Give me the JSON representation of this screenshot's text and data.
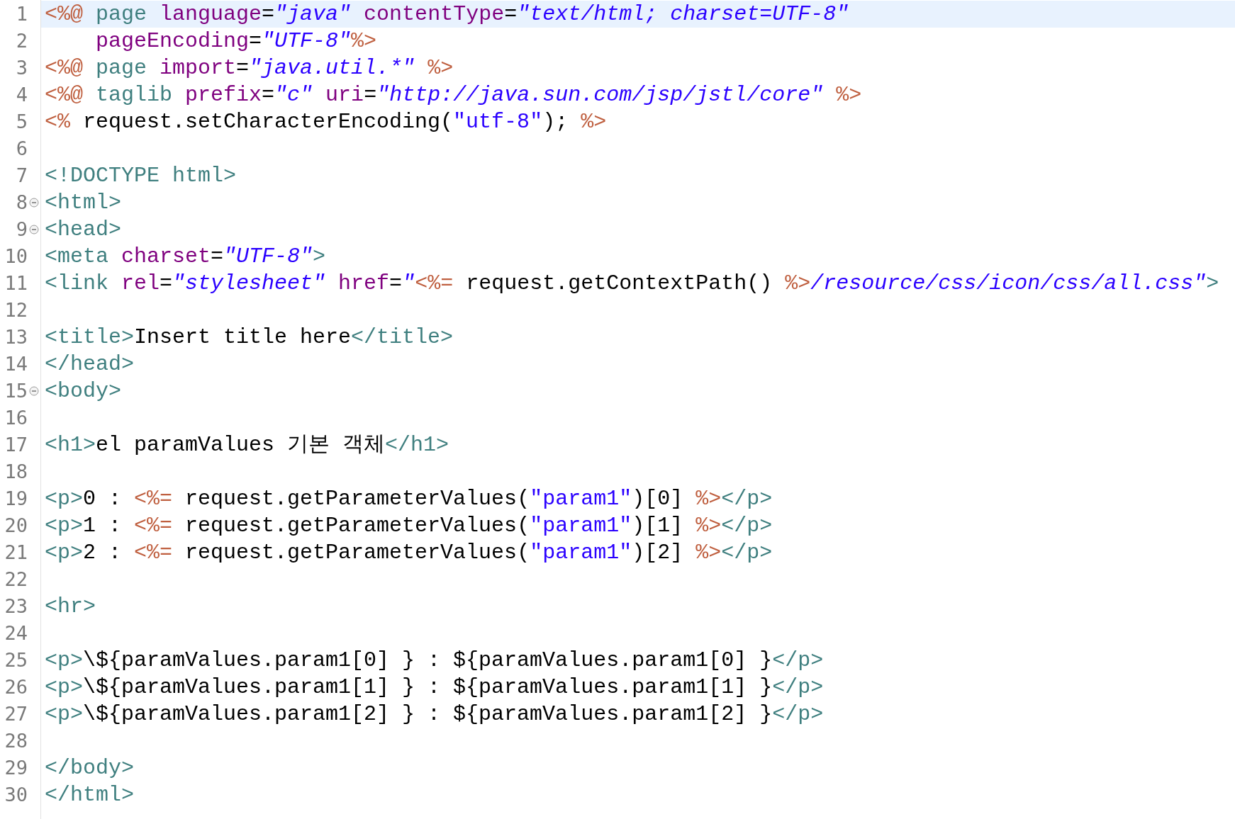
{
  "editor": {
    "lines": [
      {
        "number": "1",
        "current": true,
        "tokens": [
          {
            "kind": "jsp",
            "text": "<%@"
          },
          {
            "kind": "tag",
            "text": " page"
          },
          {
            "kind": "attr",
            "text": " language"
          },
          {
            "kind": "text",
            "text": "="
          },
          {
            "kind": "str",
            "text": "\"java\""
          },
          {
            "kind": "attr",
            "text": " contentType"
          },
          {
            "kind": "text",
            "text": "="
          },
          {
            "kind": "str",
            "text": "\"text/html; charset=UTF-8\""
          }
        ]
      },
      {
        "number": "2",
        "current": false,
        "tokens": [
          {
            "kind": "attr",
            "text": "    pageEncoding"
          },
          {
            "kind": "text",
            "text": "="
          },
          {
            "kind": "str",
            "text": "\"UTF-8\""
          },
          {
            "kind": "jsp",
            "text": "%>"
          }
        ]
      },
      {
        "number": "3",
        "current": false,
        "tokens": [
          {
            "kind": "jsp",
            "text": "<%@"
          },
          {
            "kind": "tag",
            "text": " page"
          },
          {
            "kind": "attr",
            "text": " import"
          },
          {
            "kind": "text",
            "text": "="
          },
          {
            "kind": "str",
            "text": "\"java.util.*\""
          },
          {
            "kind": "jsp",
            "text": " %>"
          }
        ]
      },
      {
        "number": "4",
        "current": false,
        "tokens": [
          {
            "kind": "jsp",
            "text": "<%@"
          },
          {
            "kind": "tag",
            "text": " taglib"
          },
          {
            "kind": "attr",
            "text": " prefix"
          },
          {
            "kind": "text",
            "text": "="
          },
          {
            "kind": "str",
            "text": "\"c\""
          },
          {
            "kind": "attr",
            "text": " uri"
          },
          {
            "kind": "text",
            "text": "="
          },
          {
            "kind": "str",
            "text": "\"http://java.sun.com/jsp/jstl/core\""
          },
          {
            "kind": "jsp",
            "text": " %>"
          }
        ]
      },
      {
        "number": "5",
        "current": false,
        "tokens": [
          {
            "kind": "jsp",
            "text": "<%"
          },
          {
            "kind": "text",
            "text": " request.setCharacterEncoding("
          },
          {
            "kind": "jstr",
            "text": "\"utf-8\""
          },
          {
            "kind": "text",
            "text": ");"
          },
          {
            "kind": "jsp",
            "text": " %>"
          }
        ]
      },
      {
        "number": "6",
        "current": false
      },
      {
        "number": "7",
        "current": false,
        "tokens": [
          {
            "kind": "tag",
            "text": "<!DOCTYPE html>"
          }
        ]
      },
      {
        "number": "8",
        "current": false,
        "foldable": true,
        "tokens": [
          {
            "kind": "tag",
            "text": "<html>"
          }
        ]
      },
      {
        "number": "9",
        "current": false,
        "foldable": true,
        "tokens": [
          {
            "kind": "tag",
            "text": "<head>"
          }
        ]
      },
      {
        "number": "10",
        "current": false,
        "tokens": [
          {
            "kind": "tag",
            "text": "<meta"
          },
          {
            "kind": "attr",
            "text": " charset"
          },
          {
            "kind": "text",
            "text": "="
          },
          {
            "kind": "str",
            "text": "\"UTF-8\""
          },
          {
            "kind": "tag",
            "text": ">"
          }
        ]
      },
      {
        "number": "11",
        "current": false,
        "tokens": [
          {
            "kind": "tag",
            "text": "<link"
          },
          {
            "kind": "attr",
            "text": " rel"
          },
          {
            "kind": "text",
            "text": "="
          },
          {
            "kind": "str",
            "text": "\"stylesheet\""
          },
          {
            "kind": "attr",
            "text": " href"
          },
          {
            "kind": "text",
            "text": "="
          },
          {
            "kind": "str",
            "text": "\""
          },
          {
            "kind": "jsp",
            "text": "<%="
          },
          {
            "kind": "text",
            "text": " request.getContextPath() "
          },
          {
            "kind": "jsp",
            "text": "%>"
          },
          {
            "kind": "str",
            "text": "/resource/css/icon/css/all.css\""
          },
          {
            "kind": "tag",
            "text": ">"
          }
        ]
      },
      {
        "number": "12",
        "current": false
      },
      {
        "number": "13",
        "current": false,
        "tokens": [
          {
            "kind": "tag",
            "text": "<title>"
          },
          {
            "kind": "text",
            "text": "Insert title here"
          },
          {
            "kind": "tag",
            "text": "</title>"
          }
        ]
      },
      {
        "number": "14",
        "current": false,
        "tokens": [
          {
            "kind": "tag",
            "text": "</head>"
          }
        ]
      },
      {
        "number": "15",
        "current": false,
        "foldable": true,
        "tokens": [
          {
            "kind": "tag",
            "text": "<body>"
          }
        ]
      },
      {
        "number": "16",
        "current": false
      },
      {
        "number": "17",
        "current": false,
        "tokens": [
          {
            "kind": "tag",
            "text": "<h1>"
          },
          {
            "kind": "text",
            "text": "el paramValues 기본 객체"
          },
          {
            "kind": "tag",
            "text": "</h1>"
          }
        ]
      },
      {
        "number": "18",
        "current": false
      },
      {
        "number": "19",
        "current": false,
        "tokens": [
          {
            "kind": "tag",
            "text": "<p>"
          },
          {
            "kind": "text",
            "text": "0 : "
          },
          {
            "kind": "jsp",
            "text": "<%="
          },
          {
            "kind": "text",
            "text": " request.getParameterValues("
          },
          {
            "kind": "jstr",
            "text": "\"param1\""
          },
          {
            "kind": "text",
            "text": ")[0] "
          },
          {
            "kind": "jsp",
            "text": "%>"
          },
          {
            "kind": "tag",
            "text": "</p>"
          }
        ]
      },
      {
        "number": "20",
        "current": false,
        "tokens": [
          {
            "kind": "tag",
            "text": "<p>"
          },
          {
            "kind": "text",
            "text": "1 : "
          },
          {
            "kind": "jsp",
            "text": "<%="
          },
          {
            "kind": "text",
            "text": " request.getParameterValues("
          },
          {
            "kind": "jstr",
            "text": "\"param1\""
          },
          {
            "kind": "text",
            "text": ")[1] "
          },
          {
            "kind": "jsp",
            "text": "%>"
          },
          {
            "kind": "tag",
            "text": "</p>"
          }
        ]
      },
      {
        "number": "21",
        "current": false,
        "tokens": [
          {
            "kind": "tag",
            "text": "<p>"
          },
          {
            "kind": "text",
            "text": "2 : "
          },
          {
            "kind": "jsp",
            "text": "<%="
          },
          {
            "kind": "text",
            "text": " request.getParameterValues("
          },
          {
            "kind": "jstr",
            "text": "\"param1\""
          },
          {
            "kind": "text",
            "text": ")[2] "
          },
          {
            "kind": "jsp",
            "text": "%>"
          },
          {
            "kind": "tag",
            "text": "</p>"
          }
        ]
      },
      {
        "number": "22",
        "current": false
      },
      {
        "number": "23",
        "current": false,
        "tokens": [
          {
            "kind": "tag",
            "text": "<hr>"
          }
        ]
      },
      {
        "number": "24",
        "current": false
      },
      {
        "number": "25",
        "current": false,
        "tokens": [
          {
            "kind": "tag",
            "text": "<p>"
          },
          {
            "kind": "text",
            "text": "\\${paramValues.param1[0] } : ${paramValues.param1[0] }"
          },
          {
            "kind": "tag",
            "text": "</p>"
          }
        ]
      },
      {
        "number": "26",
        "current": false,
        "tokens": [
          {
            "kind": "tag",
            "text": "<p>"
          },
          {
            "kind": "text",
            "text": "\\${paramValues.param1[1] } : ${paramValues.param1[1] }"
          },
          {
            "kind": "tag",
            "text": "</p>"
          }
        ]
      },
      {
        "number": "27",
        "current": false,
        "tokens": [
          {
            "kind": "tag",
            "text": "<p>"
          },
          {
            "kind": "text",
            "text": "\\${paramValues.param1[2] } : ${paramValues.param1[2] }"
          },
          {
            "kind": "tag",
            "text": "</p>"
          }
        ]
      },
      {
        "number": "28",
        "current": false
      },
      {
        "number": "29",
        "current": false,
        "tokens": [
          {
            "kind": "tag",
            "text": "</body>"
          }
        ]
      },
      {
        "number": "30",
        "current": false,
        "tokens": [
          {
            "kind": "tag",
            "text": "</html>"
          }
        ]
      }
    ]
  }
}
